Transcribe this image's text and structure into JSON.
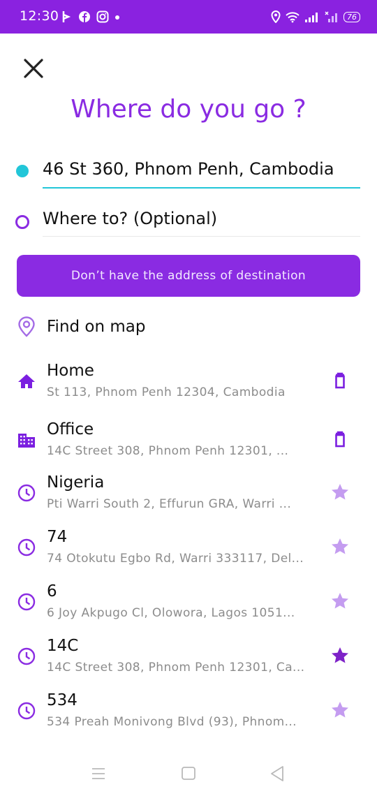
{
  "status_bar": {
    "time": "12:30",
    "battery": "76"
  },
  "page": {
    "title": "Where do you go ?"
  },
  "route": {
    "origin": "46 St 360, Phnom Penh, Cambodia",
    "destination_placeholder": "Where to? (Optional)"
  },
  "no_address_button": "Don’t have the address of destination",
  "find_on_map": "Find on map",
  "saved": [
    {
      "name": "Home",
      "address": "St 113, Phnom Penh 12304, Cambodia",
      "icon": "home-icon",
      "action": "delete"
    },
    {
      "name": "Office",
      "address": "14C Street 308, Phnom Penh 12301, ...",
      "icon": "building-icon",
      "action": "delete"
    }
  ],
  "recent": [
    {
      "name": "Nigeria",
      "address": "Pti Warri South 2, Effurun GRA, Warri ...",
      "favorite": false
    },
    {
      "name": "74",
      "address": "74 Otokutu Egbo Rd, Warri 333117, Del...",
      "favorite": false
    },
    {
      "name": "6",
      "address": "6 Joy Akpugo Cl, Olowora, Lagos 1051...",
      "favorite": false
    },
    {
      "name": "14C",
      "address": "14C Street 308, Phnom Penh 12301, Ca...",
      "favorite": true
    },
    {
      "name": "534",
      "address": "534 Preah Monivong Blvd (93), Phnom...",
      "favorite": false
    }
  ],
  "colors": {
    "accent": "#8a2be2",
    "status_bar": "#8a22e0",
    "origin_dot": "#22c6d8",
    "star_inactive": "#c49cf0",
    "star_active": "#8a2be2"
  }
}
